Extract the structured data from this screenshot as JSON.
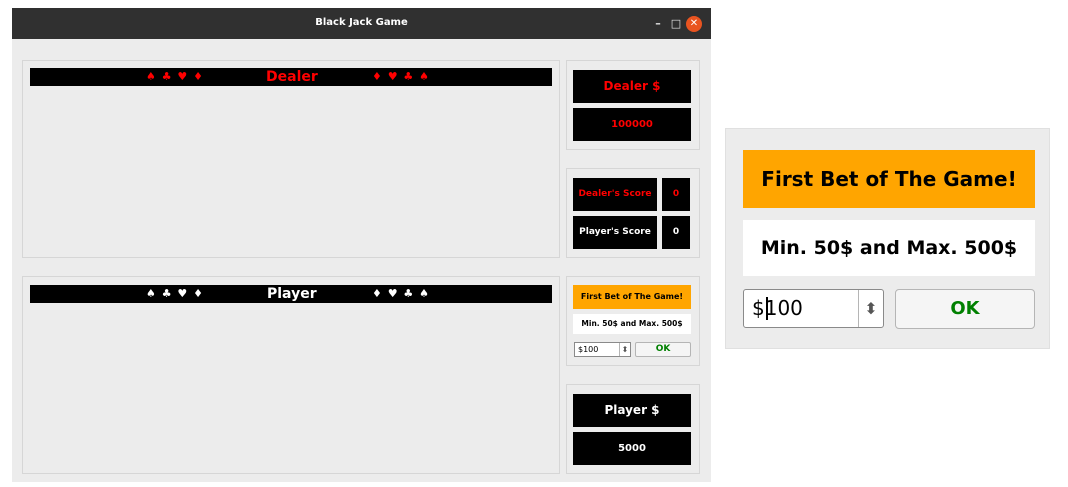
{
  "window": {
    "title": "Black Jack Game",
    "minimize_glyph": "–",
    "maximize_glyph": "□",
    "close_glyph": "✕"
  },
  "dealer": {
    "banner": {
      "left_suits": "♠ ♣ ♥ ♦",
      "label": "Dealer",
      "right_suits": "♦ ♥ ♣ ♠"
    },
    "money_label": "Dealer $",
    "money_value": "100000"
  },
  "scores": {
    "dealer_label": "Dealer's Score",
    "dealer_value": "0",
    "player_label": "Player's Score",
    "player_value": "0"
  },
  "player": {
    "banner": {
      "left_suits": "♠ ♣ ♥ ♦",
      "label": "Player",
      "right_suits": "♦ ♥ ♣ ♠"
    },
    "money_label": "Player $",
    "money_value": "5000"
  },
  "bet": {
    "header": "First Bet of The Game!",
    "limits": "Min. 50$ and Max. 500$",
    "input_value": "$100",
    "spinner_glyph": "⬍",
    "ok_label": "OK"
  },
  "colors": {
    "dealer_red": "#ff0000",
    "bet_orange": "#ffa500",
    "ok_green": "#008000",
    "close_orange": "#e95420"
  }
}
